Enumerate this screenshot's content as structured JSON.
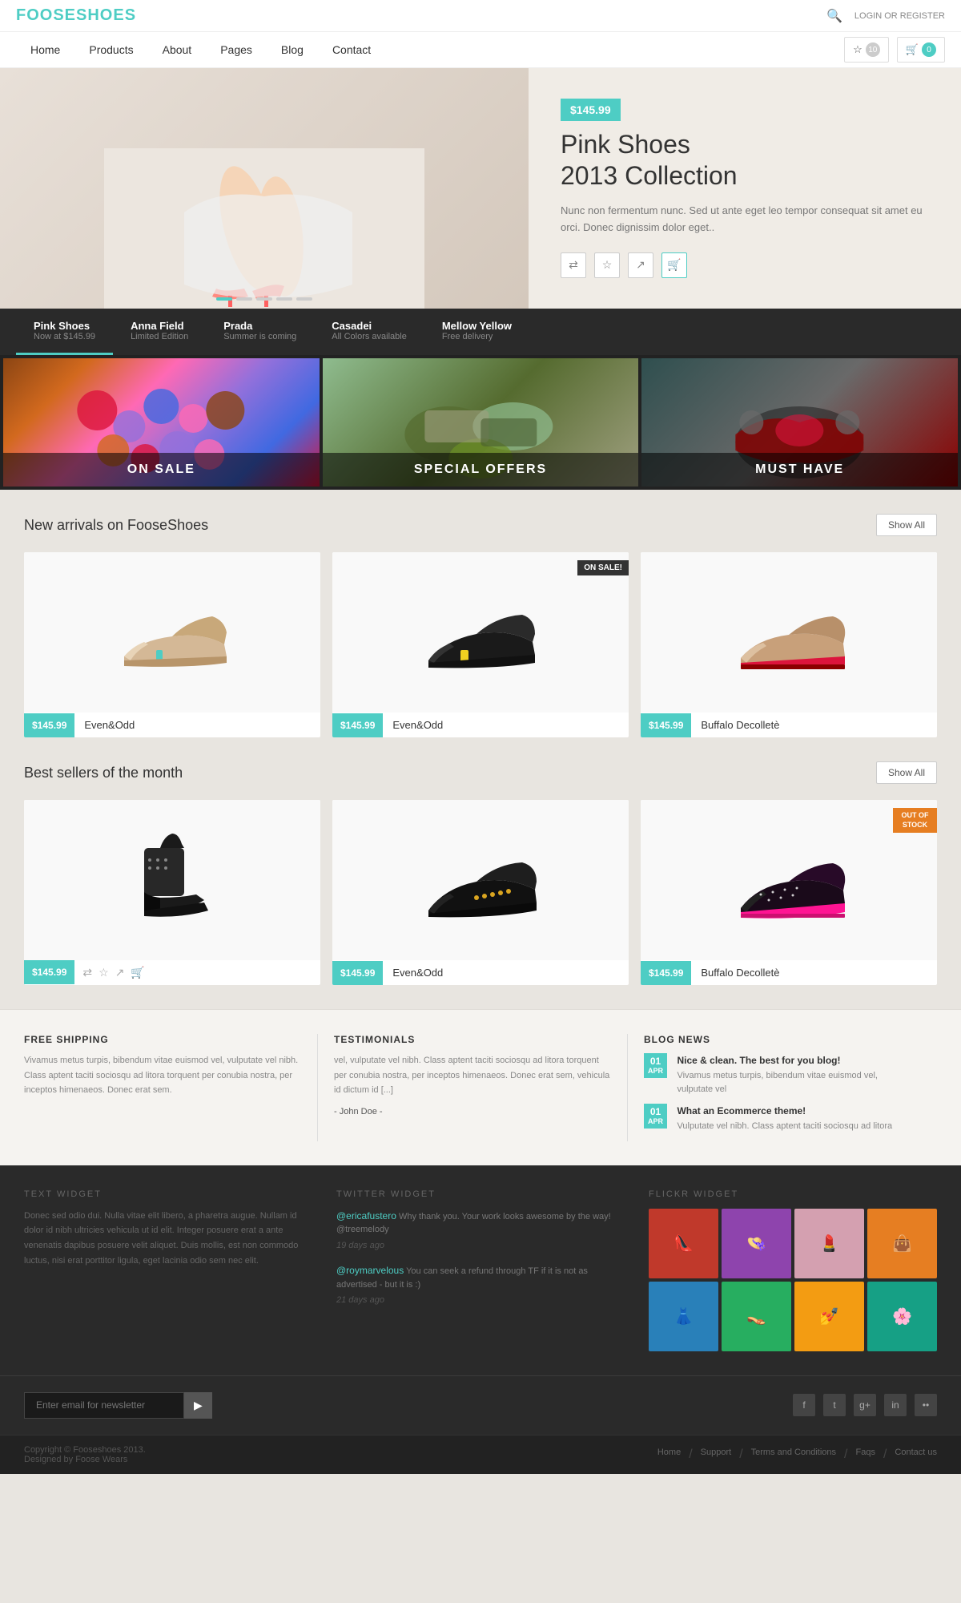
{
  "brand": {
    "name": "FOOSESHOES",
    "tagline": "FOOSE"
  },
  "topbar": {
    "login_text": "LOGIN or REGISTER",
    "search_placeholder": "Search..."
  },
  "nav": {
    "items": [
      {
        "label": "Home",
        "active": false
      },
      {
        "label": "Products",
        "active": false
      },
      {
        "label": "About",
        "active": false
      },
      {
        "label": "Pages",
        "active": false
      },
      {
        "label": "Blog",
        "active": false
      },
      {
        "label": "Contact",
        "active": false
      }
    ],
    "wishlist_count": "10",
    "cart_count": "0"
  },
  "hero": {
    "price": "$145.99",
    "title_line1": "Pink Shoes",
    "title_line2": "2013 Collection",
    "description": "Nunc non fermentum nunc. Sed ut ante eget leo tempor consequat sit amet eu orci. Donec dignissim dolor eget..",
    "slider_dots": [
      true,
      false,
      false,
      false,
      false
    ]
  },
  "product_tabs": [
    {
      "name": "Pink Shoes",
      "subtitle": "Now at $145.99",
      "active": true
    },
    {
      "name": "Anna Field",
      "subtitle": "Limited Edition",
      "active": false
    },
    {
      "name": "Prada",
      "subtitle": "Summer is coming",
      "active": false
    },
    {
      "name": "Casadei",
      "subtitle": "All Colors available",
      "active": false
    },
    {
      "name": "Mellow Yellow",
      "subtitle": "Free delivery",
      "active": false
    }
  ],
  "category_banners": [
    {
      "label": "ON SALE"
    },
    {
      "label": "SPECIAL OFFERS"
    },
    {
      "label": "MUST HAVE"
    }
  ],
  "new_arrivals": {
    "title": "New arrivals on FooseShoes",
    "show_all": "Show All",
    "products": [
      {
        "price": "$145.99",
        "name": "Even&Odd",
        "on_sale": false,
        "out_of_stock": false
      },
      {
        "price": "$145.99",
        "name": "Even&Odd",
        "on_sale": true,
        "out_of_stock": false
      },
      {
        "price": "$145.99",
        "name": "Buffalo Decolletè",
        "on_sale": false,
        "out_of_stock": false
      }
    ]
  },
  "best_sellers": {
    "title": "Best sellers of the month",
    "show_all": "Show All",
    "products": [
      {
        "price": "$145.99",
        "name": "",
        "on_sale": false,
        "out_of_stock": false
      },
      {
        "price": "$145.99",
        "name": "Even&Odd",
        "on_sale": false,
        "out_of_stock": false
      },
      {
        "price": "$145.99",
        "name": "Buffalo Decolletè",
        "on_sale": false,
        "out_of_stock": true
      }
    ]
  },
  "footer_info": {
    "shipping": {
      "title": "FREE SHIPPING",
      "text": "Vivamus metus turpis, bibendum vitae euismod vel, vulputate vel nibh. Class aptent taciti sociosqu ad litora torquent per conubia nostra, per inceptos himenaeos. Donec erat sem."
    },
    "testimonials": {
      "title": "TESTIMONIALS",
      "text": "vel, vulputate vel nibh. Class aptent taciti sociosqu ad litora torquent per conubia nostra, per inceptos himenaeos. Donec erat sem, vehicula id dictum id [...]",
      "author": "- John Doe -"
    },
    "blog": {
      "title": "BLOG NEWS",
      "items": [
        {
          "month": "APR",
          "day": "01",
          "title": "Nice & clean. The best for you blog!",
          "excerpt": "Vivamus metus turpis, bibendum vitae euismod vel, vulputate vel"
        },
        {
          "month": "APR",
          "day": "01",
          "title": "What an Ecommerce theme!",
          "excerpt": "Vulputate vel nibh. Class aptent taciti sociosqu ad litora"
        }
      ]
    }
  },
  "dark_footer": {
    "text_widget": {
      "title": "TEXT WIDGET",
      "text": "Donec sed odio dui. Nulla vitae elit libero, a pharetra augue. Nullam id dolor id nibh ultricies vehicula ut id elit. Integer posuere erat a ante venenatis dapibus posuere velit aliquet. Duis mollis, est non commodo luctus, nisi erat porttitor ligula, eget lacinia odio sem nec elit."
    },
    "twitter_widget": {
      "title": "TWITTER WIDGET",
      "tweets": [
        {
          "handle": "@ericafustero",
          "text": "Why thank you. Your work looks awesome by the way! @treemelody",
          "time": "19 days ago"
        },
        {
          "handle": "@roymarvelous",
          "text": "You can seek a refund through TF if it is not as advertised - but it is :)",
          "time": "21 days ago"
        }
      ]
    },
    "flickr_widget": {
      "title": "FLICKR WIDGET",
      "thumbs": [
        "👠",
        "👒",
        "💄",
        "👜",
        "👗",
        "👡",
        "💅",
        "🌸"
      ]
    }
  },
  "newsletter": {
    "placeholder": "Enter email for newsletter",
    "button_icon": "▶"
  },
  "social": {
    "icons": [
      "f",
      "t",
      "g+",
      "in",
      "••"
    ]
  },
  "bottom_bar": {
    "copyright": "Copyright © Fooseshoes 2013.\nDesigned by Foose Wears",
    "links": [
      "Home",
      "Support",
      "Terms and Conditions",
      "Faqs",
      "Contact us"
    ]
  }
}
